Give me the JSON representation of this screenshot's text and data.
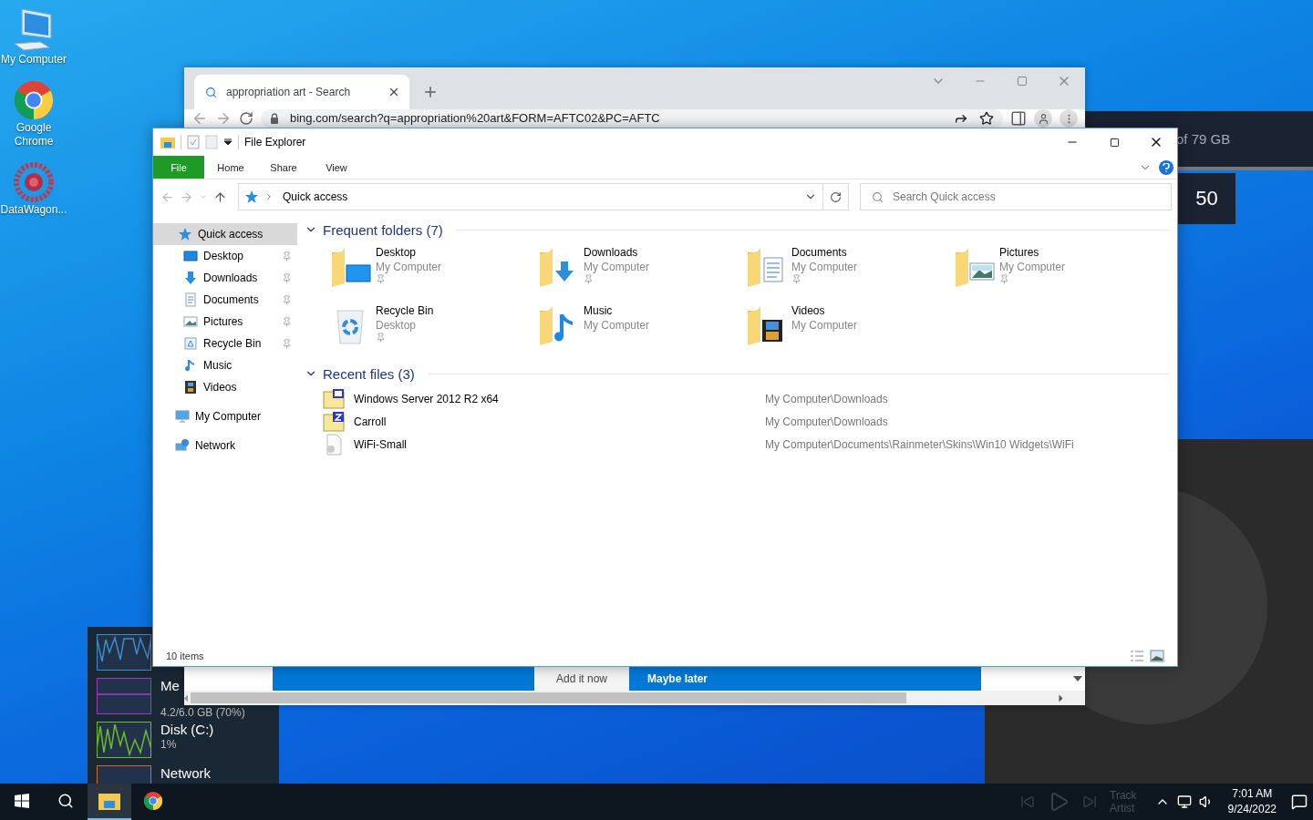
{
  "desktop_icons": [
    {
      "kind": "computer",
      "label": "My Computer"
    },
    {
      "kind": "chrome",
      "label": "Google Chrome"
    },
    {
      "kind": "datawagon",
      "label": "DataWagon..."
    }
  ],
  "browser": {
    "tab_title": "appropriation art - Search",
    "url": "bing.com/search?q=appropriation%20art&FORM=AFTC02&PC=AFTC",
    "banner_buttons": [
      {
        "kind": "secondary",
        "label": "Add it now"
      },
      {
        "kind": "primary",
        "label": "Maybe later"
      }
    ]
  },
  "storage_widget": {
    "text": "of 79 GB"
  },
  "counter_widget": {
    "value": "50"
  },
  "system_monitor": [
    {
      "kind": "cpu"
    },
    {
      "kind": "memory",
      "label": "Me",
      "detail": "4.2/6.0 GB (70%)"
    },
    {
      "kind": "disk",
      "label": "Disk (C:)",
      "detail": "1%"
    },
    {
      "kind": "network",
      "label": "Network"
    }
  ],
  "explorer": {
    "title": "File Explorer",
    "ribbon_tabs": [
      {
        "kind": "file",
        "label": "File"
      },
      {
        "kind": "tab",
        "label": "Home"
      },
      {
        "kind": "tab",
        "label": "Share"
      },
      {
        "kind": "tab",
        "label": "View"
      }
    ],
    "address": "Quick access",
    "search": {
      "placeholder": "Search Quick access"
    },
    "nav_tree": [
      {
        "kind": "quick",
        "label": "Quick access",
        "selected": true,
        "children": [
          {
            "kind": "desktop",
            "label": "Desktop",
            "selected": false,
            "pinned": true
          },
          {
            "kind": "downloads",
            "label": "Downloads",
            "selected": false,
            "pinned": true
          },
          {
            "kind": "documents",
            "label": "Documents",
            "selected": false,
            "pinned": true
          },
          {
            "kind": "pictures",
            "label": "Pictures",
            "selected": false,
            "pinned": true
          },
          {
            "kind": "recycle",
            "label": "Recycle Bin",
            "selected": false,
            "pinned": true
          },
          {
            "kind": "music",
            "label": "Music",
            "selected": false,
            "pinned": false
          },
          {
            "kind": "videos",
            "label": "Videos",
            "selected": false,
            "pinned": false
          }
        ]
      },
      {
        "kind": "computer",
        "label": "My Computer",
        "selected": false
      },
      {
        "kind": "network",
        "label": "Network",
        "selected": false
      }
    ],
    "frequent": {
      "heading": "Frequent folders (7)",
      "expanded": true,
      "items": [
        {
          "kind": "desktop",
          "name": "Desktop",
          "location": "My Computer",
          "pinned": true
        },
        {
          "kind": "downloads",
          "name": "Downloads",
          "location": "My Computer",
          "pinned": true
        },
        {
          "kind": "documents",
          "name": "Documents",
          "location": "My Computer",
          "pinned": true
        },
        {
          "kind": "pictures",
          "name": "Pictures",
          "location": "My Computer",
          "pinned": true
        },
        {
          "kind": "recycle",
          "name": "Recycle Bin",
          "location": "Desktop",
          "pinned": true
        },
        {
          "kind": "music",
          "name": "Music",
          "location": "My Computer",
          "pinned": false
        },
        {
          "kind": "videos",
          "name": "Videos",
          "location": "My Computer",
          "pinned": false
        }
      ]
    },
    "recent": {
      "heading": "Recent files (3)",
      "expanded": true,
      "items": [
        {
          "kind": "iso",
          "name": "Windows Server 2012 R2 x64",
          "path": "My Computer\\Downloads"
        },
        {
          "kind": "zip",
          "name": "Carroll",
          "path": "My Computer\\Downloads"
        },
        {
          "kind": "file",
          "name": "WiFi-Small",
          "path": "My Computer\\Documents\\Rainmeter\\Skins\\Win10 Widgets\\WiFi"
        }
      ]
    },
    "status": "10 items"
  },
  "taskbar": {
    "apps": [
      {
        "kind": "explorer",
        "selected": true
      },
      {
        "kind": "chrome",
        "selected": false
      }
    ],
    "media": {
      "track": "Track",
      "artist": "Artist"
    },
    "time": "7:01 AM",
    "date": "9/24/2022"
  }
}
